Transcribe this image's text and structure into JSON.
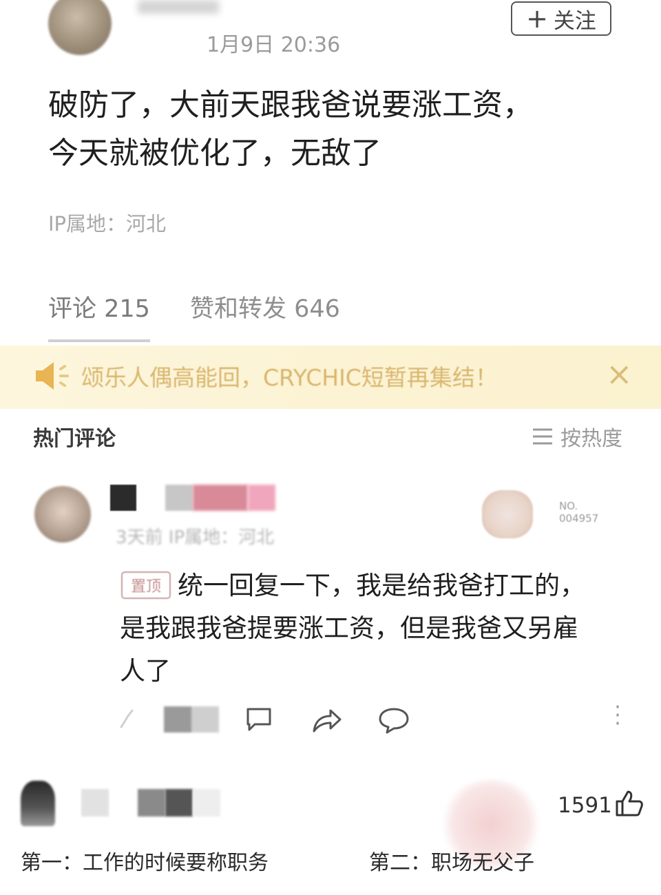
{
  "post": {
    "date": "1月9日 20:36",
    "follow_label": "关注",
    "body_lines": [
      "破防了，大前天跟我爸说要涨工资，",
      "今天就被优化了，无敌了"
    ],
    "ip_location": "IP属地：河北"
  },
  "tabs": {
    "comments": "评论 215",
    "likes_reposts": "赞和转发 646"
  },
  "banner": {
    "text": "颂乐人偶高能回，CRYCHIC短暂再集结！",
    "close_icon": "close-icon"
  },
  "hot_comments": {
    "label": "热门评论",
    "sort_label": "按热度"
  },
  "comment1": {
    "meta": "3天前 IP属地：河北",
    "badge_text": "NO.\n004957",
    "pinned_tag": "置顶",
    "lines": [
      "统一回复一下，我是给我爸打工的，",
      "是我跟我爸提要涨工资，但是我爸又另雇",
      "人了"
    ]
  },
  "comment2": {
    "like_count": "1591",
    "text_a": "第一：工作的时候要称职务",
    "text_b": "第二：职场无父子"
  },
  "colors": {
    "banner_bg": "#fcf3d4",
    "banner_text": "#d9b66e"
  }
}
